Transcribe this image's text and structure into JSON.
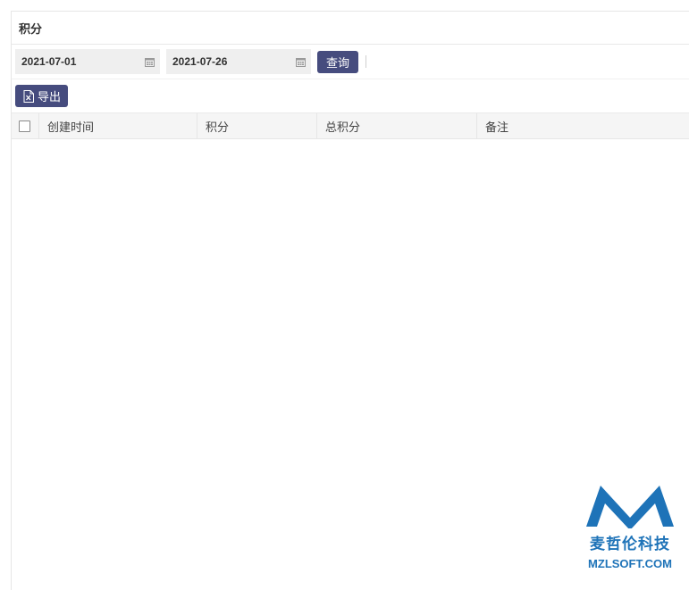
{
  "panel": {
    "title": "积分"
  },
  "filters": {
    "start_date": "2021-07-01",
    "end_date": "2021-07-26",
    "calendar_icon": "calendar-icon",
    "query_label": "查询"
  },
  "actions": {
    "export_label": "导出",
    "export_icon": "excel-file-icon"
  },
  "table": {
    "columns": [
      "创建时间",
      "积分",
      "总积分",
      "备注"
    ],
    "rows": []
  },
  "watermark": {
    "brand_cn": "麦哲伦科技",
    "brand_en": "MZLSOFT.COM",
    "color": "#1e73b8"
  },
  "colors": {
    "button_bg": "#464c7e",
    "header_bg": "#f5f5f5"
  }
}
